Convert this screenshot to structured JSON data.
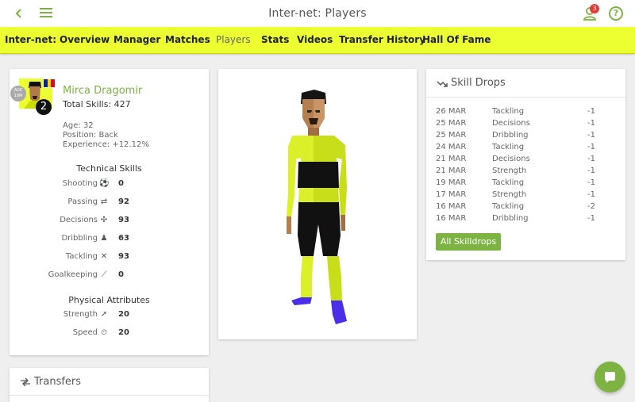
{
  "topbar": {
    "title": "Inter-net: Players",
    "notification_count": "3",
    "back_icon": "chevron-left-icon",
    "menu_icon": "hamburger-menu-icon",
    "user_icon": "user-icon",
    "help_icon": "help-icon",
    "help_glyph": "?"
  },
  "nav": {
    "items": [
      {
        "label": "Inter-net:"
      },
      {
        "label": "Overview"
      },
      {
        "label": "Manager"
      },
      {
        "label": "Matches"
      },
      {
        "label": "Players",
        "active": true
      },
      {
        "label": "Stats"
      },
      {
        "label": "Videos"
      },
      {
        "label": "Transfer History"
      },
      {
        "label": "Hall Of Fame"
      }
    ]
  },
  "player": {
    "name": "Mirca Dragomir",
    "total_skills": "Total Skills: 427",
    "number": "2",
    "age_badge_line1": "AGE",
    "age_badge_line2": "10M",
    "age": "Age: 32",
    "position": "Position: Back",
    "experience": "Experience: +12.12%",
    "technical_title": "Technical Skills",
    "technical": [
      {
        "label": "Shooting",
        "value": "0",
        "icon": "shooting-icon"
      },
      {
        "label": "Passing",
        "value": "92",
        "icon": "passing-icon"
      },
      {
        "label": "Decisions",
        "value": "93",
        "icon": "decisions-icon"
      },
      {
        "label": "Dribbling",
        "value": "63",
        "icon": "dribbling-icon"
      },
      {
        "label": "Tackling",
        "value": "93",
        "icon": "tackling-icon"
      },
      {
        "label": "Goalkeeping",
        "value": "0",
        "icon": "goalkeeping-icon"
      }
    ],
    "physical_title": "Physical Attributes",
    "physical": [
      {
        "label": "Strength",
        "value": "20",
        "icon": "strength-icon"
      },
      {
        "label": "Speed",
        "value": "20",
        "icon": "speed-icon"
      }
    ]
  },
  "skill_drops": {
    "title": "Skill Drops",
    "icon": "trending-down-icon",
    "rows": [
      {
        "date": "26 MAR",
        "skill": "Tackling",
        "change": "-1"
      },
      {
        "date": "25 MAR",
        "skill": "Decisions",
        "change": "-1"
      },
      {
        "date": "25 MAR",
        "skill": "Dribbling",
        "change": "-1"
      },
      {
        "date": "24 MAR",
        "skill": "Tackling",
        "change": "-1"
      },
      {
        "date": "21 MAR",
        "skill": "Decisions",
        "change": "-1"
      },
      {
        "date": "21 MAR",
        "skill": "Strength",
        "change": "-1"
      },
      {
        "date": "19 MAR",
        "skill": "Tackling",
        "change": "-1"
      },
      {
        "date": "17 MAR",
        "skill": "Strength",
        "change": "-1"
      },
      {
        "date": "16 MAR",
        "skill": "Tackling",
        "change": "-2"
      },
      {
        "date": "16 MAR",
        "skill": "Dribbling",
        "change": "-1"
      }
    ],
    "button_label": "All Skilldrops"
  },
  "transfers": {
    "title": "Transfers",
    "icon": "transfer-arrows-icon"
  },
  "fab": {
    "icon": "chat-icon"
  },
  "colors": {
    "accent": "#7cb342",
    "kit_yellow": "#ebff31",
    "badge_red": "#e53935",
    "boots": "#4a2ee8"
  }
}
